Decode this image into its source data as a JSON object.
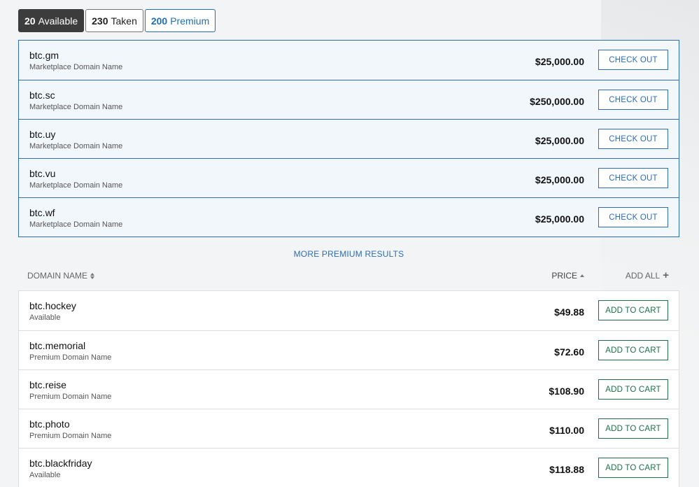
{
  "tabs": [
    {
      "count": "20",
      "label": "Available"
    },
    {
      "count": "230",
      "label": "Taken"
    },
    {
      "count": "200",
      "label": "Premium"
    }
  ],
  "premium_results": [
    {
      "domain": "btc.gm",
      "type": "Marketplace Domain Name",
      "price": "$25,000.00",
      "action": "CHECK OUT"
    },
    {
      "domain": "btc.sc",
      "type": "Marketplace Domain Name",
      "price": "$250,000.00",
      "action": "CHECK OUT"
    },
    {
      "domain": "btc.uy",
      "type": "Marketplace Domain Name",
      "price": "$25,000.00",
      "action": "CHECK OUT"
    },
    {
      "domain": "btc.vu",
      "type": "Marketplace Domain Name",
      "price": "$25,000.00",
      "action": "CHECK OUT"
    },
    {
      "domain": "btc.wf",
      "type": "Marketplace Domain Name",
      "price": "$25,000.00",
      "action": "CHECK OUT"
    }
  ],
  "more_premium_label": "MORE PREMIUM RESULTS",
  "columns": {
    "domain_name": "DOMAIN NAME",
    "price": "PRICE",
    "add_all": "ADD ALL"
  },
  "results": [
    {
      "domain": "btc.hockey",
      "type": "Available",
      "price": "$49.88",
      "action": "ADD TO CART"
    },
    {
      "domain": "btc.memorial",
      "type": "Premium Domain Name",
      "price": "$72.60",
      "action": "ADD TO CART"
    },
    {
      "domain": "btc.reise",
      "type": "Premium Domain Name",
      "price": "$108.90",
      "action": "ADD TO CART"
    },
    {
      "domain": "btc.photo",
      "type": "Premium Domain Name",
      "price": "$110.00",
      "action": "ADD TO CART"
    },
    {
      "domain": "btc.blackfriday",
      "type": "Available",
      "price": "$118.88",
      "action": "ADD TO CART"
    }
  ],
  "colors": {
    "premium_blue": "#2d6db5",
    "cart_green": "#1f6e4a",
    "active_tab": "#3c3c3c"
  }
}
